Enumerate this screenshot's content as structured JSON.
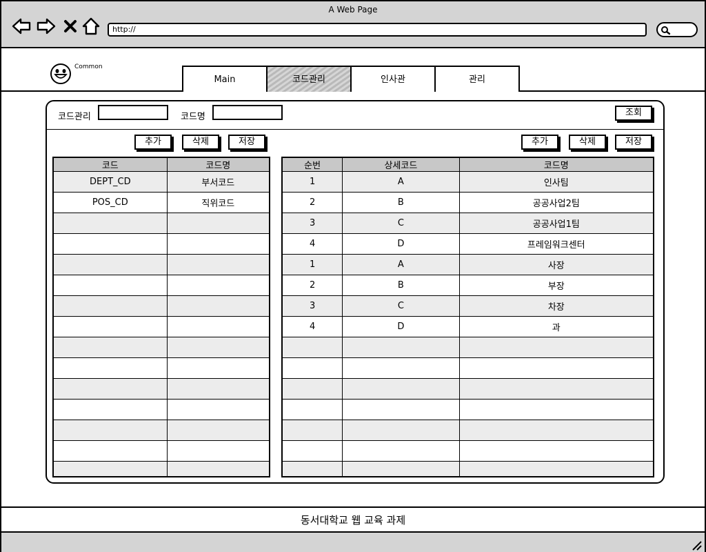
{
  "window": {
    "title": "A Web Page"
  },
  "browser": {
    "url": "http://"
  },
  "header": {
    "logo_text": "Common",
    "tabs": [
      {
        "label": "Main",
        "active": false
      },
      {
        "label": "코드관리",
        "active": true
      },
      {
        "label": "인사관",
        "active": false
      },
      {
        "label": "관리",
        "active": false
      }
    ]
  },
  "search": {
    "code_label": "코드관리",
    "code_value": "",
    "name_label": "코드명",
    "name_value": "",
    "query_button": "조회"
  },
  "left_toolbar": {
    "add": "추가",
    "delete": "삭제",
    "save": "저장"
  },
  "right_toolbar": {
    "add": "추가",
    "delete": "삭제",
    "save": "저장"
  },
  "code_table": {
    "headers": [
      "코드",
      "코드명"
    ],
    "rows": [
      [
        "DEPT_CD",
        "부서코드"
      ],
      [
        "POS_CD",
        "직위코드"
      ],
      [
        "",
        ""
      ],
      [
        "",
        ""
      ],
      [
        "",
        ""
      ],
      [
        "",
        ""
      ],
      [
        "",
        ""
      ],
      [
        "",
        ""
      ],
      [
        "",
        ""
      ],
      [
        "",
        ""
      ],
      [
        "",
        ""
      ],
      [
        "",
        ""
      ],
      [
        "",
        ""
      ],
      [
        "",
        ""
      ],
      [
        "",
        ""
      ]
    ]
  },
  "detail_table": {
    "headers": [
      "순번",
      "상세코드",
      "코드명"
    ],
    "rows": [
      [
        "1",
        "A",
        "인사팀"
      ],
      [
        "2",
        "B",
        "공공사업2팀"
      ],
      [
        "3",
        "C",
        "공공사업1팀"
      ],
      [
        "4",
        "D",
        "프레임워크센터"
      ],
      [
        "1",
        "A",
        "사장"
      ],
      [
        "2",
        "B",
        "부장"
      ],
      [
        "3",
        "C",
        "차장"
      ],
      [
        "4",
        "D",
        "과"
      ],
      [
        "",
        "",
        ""
      ],
      [
        "",
        "",
        ""
      ],
      [
        "",
        "",
        ""
      ],
      [
        "",
        "",
        ""
      ],
      [
        "",
        "",
        ""
      ],
      [
        "",
        "",
        ""
      ],
      [
        "",
        "",
        ""
      ]
    ]
  },
  "footer": {
    "text": "동서대학교 웹 교육 과제"
  },
  "colors": {
    "chrome": "#d4d4d4",
    "header_cell": "#c8c8c8",
    "alt_row": "#ececec"
  }
}
